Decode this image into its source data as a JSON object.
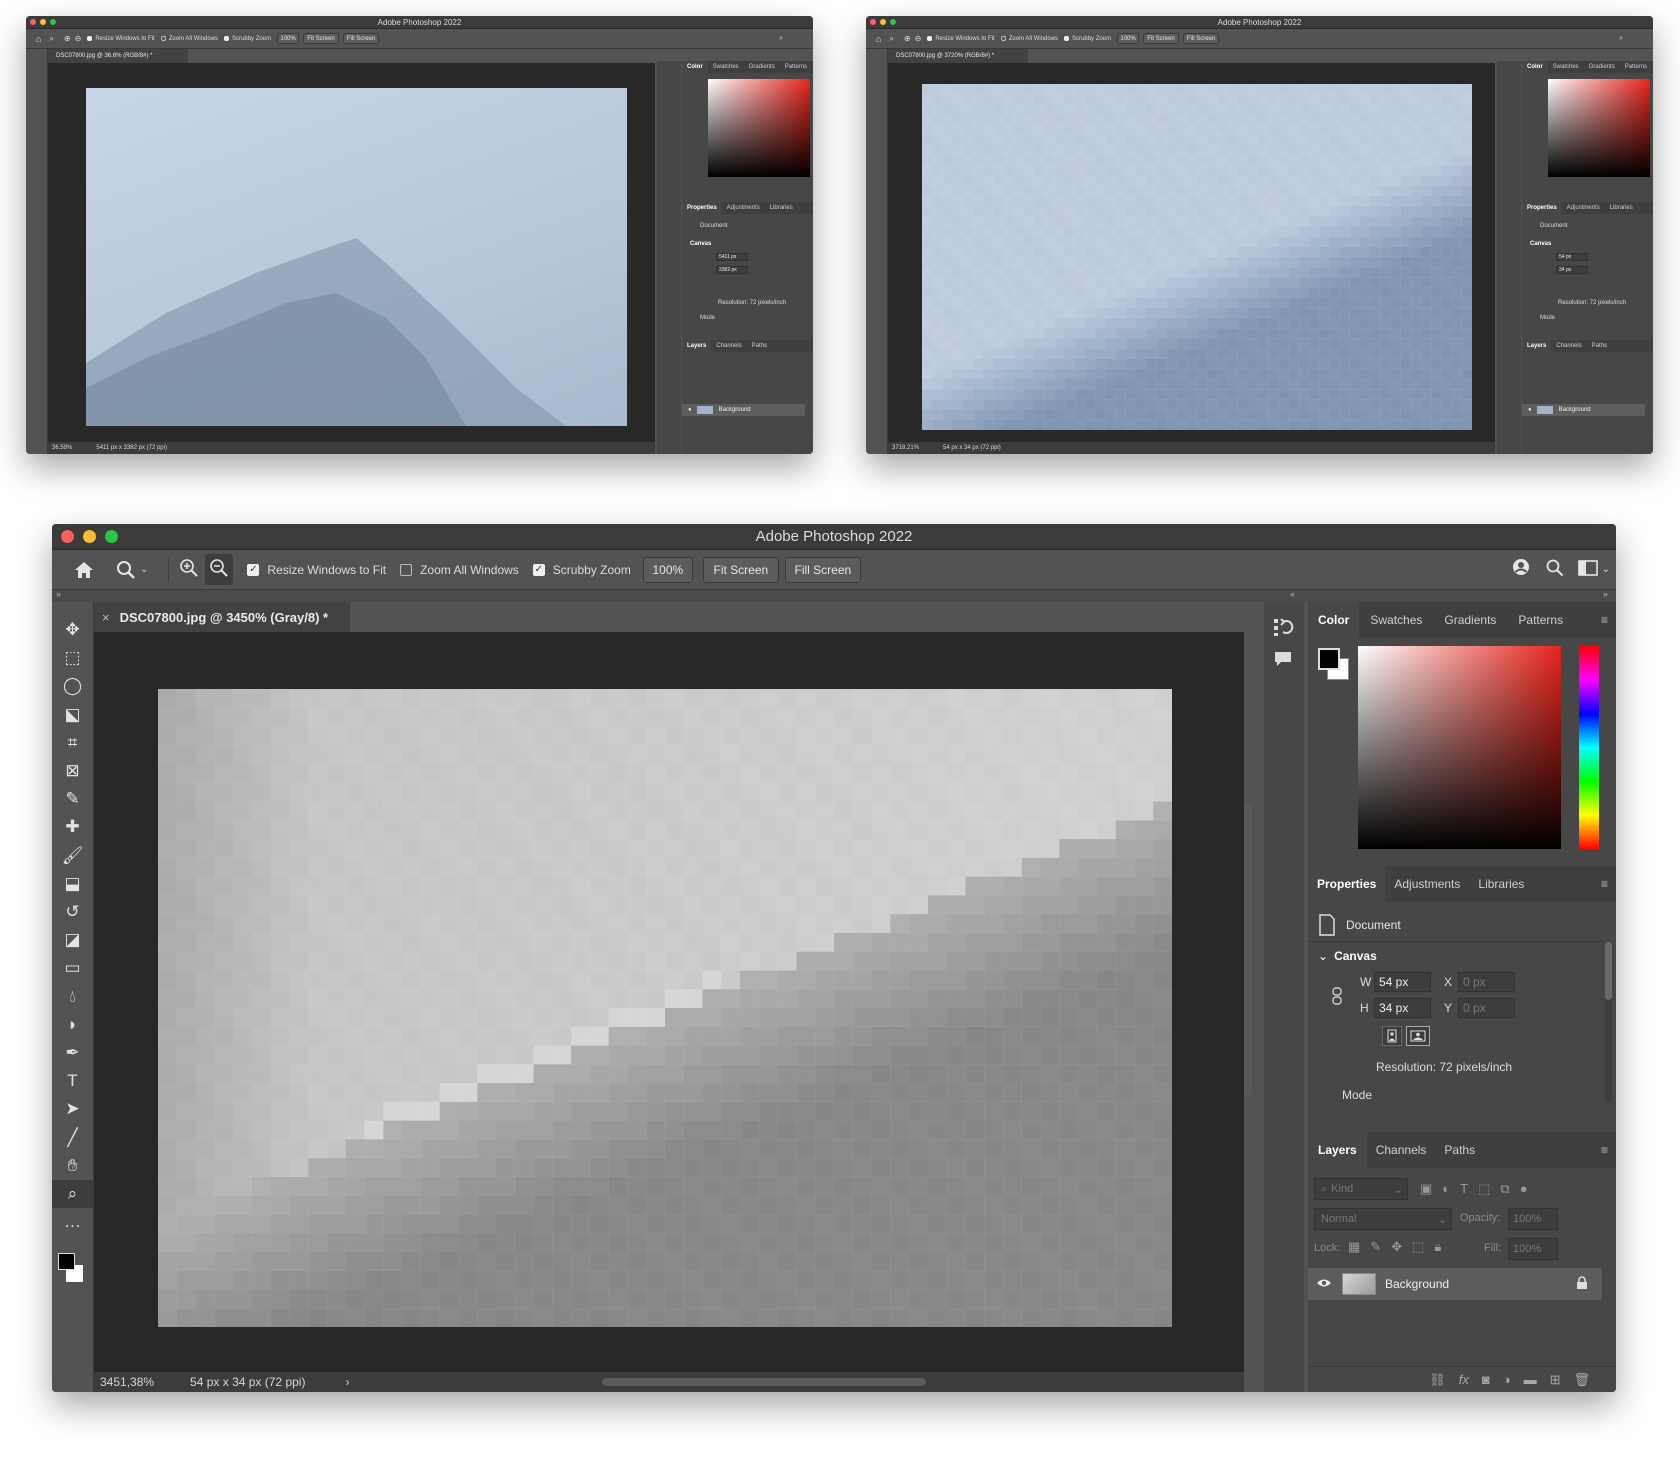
{
  "window": {
    "title": "Adobe Photoshop 2022"
  },
  "options_bar": {
    "resize_windows_label": "Resize Windows to Fit",
    "zoom_all_label": "Zoom All Windows",
    "scrubby_zoom_label": "Scrubby Zoom",
    "zoom_value": "100%",
    "fit_screen_label": "Fit Screen",
    "fill_screen_label": "Fill Screen",
    "resize_windows_checked": true,
    "zoom_all_checked": false,
    "scrubby_zoom_checked": true
  },
  "screens": [
    {
      "doc_tab": "DSC07800.jpg @ 36,6% (RGB/8#) *",
      "status_zoom": "36,59%",
      "status_size": "5411 px x 3382 px (72 ppi)",
      "width_value": "5411 px",
      "height_value": "3382 px"
    },
    {
      "doc_tab": "DSC07800.jpg @ 3720% (RGB/8#) *",
      "status_zoom": "3718,21%",
      "status_size": "54 px x 34 px (72 ppi)",
      "width_value": "54 px",
      "height_value": "34 px"
    },
    {
      "doc_tab": "DSC07800.jpg @ 3450% (Gray/8) *",
      "status_zoom": "3451,38%",
      "status_size": "54 px x 34 px (72 ppi)",
      "width_value": "54 px",
      "height_value": "34 px"
    }
  ],
  "color_panel": {
    "tabs": [
      "Color",
      "Swatches",
      "Gradients",
      "Patterns"
    ]
  },
  "properties_panel": {
    "tabs": [
      "Properties",
      "Adjustments",
      "Libraries"
    ],
    "document_label": "Document",
    "canvas_label": "Canvas",
    "w_label": "W",
    "h_label": "H",
    "x_label": "X",
    "y_label": "Y",
    "x_value": "0 px",
    "y_value": "0 px",
    "resolution": "Resolution: 72 pixels/inch",
    "mode_label": "Mode"
  },
  "layers_panel": {
    "tabs": [
      "Layers",
      "Channels",
      "Paths"
    ],
    "kind_placeholder": "Kind",
    "blend_mode": "Normal",
    "opacity_label": "Opacity:",
    "opacity_value": "100%",
    "lock_label": "Lock:",
    "fill_label": "Fill:",
    "fill_value": "100%",
    "layers": [
      {
        "name": "Background",
        "visible": true,
        "locked": true
      }
    ]
  },
  "icons": {
    "tools": [
      "move-icon",
      "marquee-icon",
      "lasso-icon",
      "object-select-icon",
      "crop-icon",
      "frame-icon",
      "eyedropper-icon",
      "healing-icon",
      "brush-icon",
      "stamp-icon",
      "history-brush-icon",
      "eraser-icon",
      "gradient-icon",
      "blur-icon",
      "dodge-icon",
      "pen-icon",
      "type-icon",
      "path-select-icon",
      "line-icon",
      "hand-icon",
      "zoom-icon",
      "more-tools-icon"
    ],
    "layer_footer": [
      "link-icon",
      "fx-icon",
      "mask-icon",
      "adjustment-icon",
      "folder-icon",
      "new-layer-icon",
      "trash-icon"
    ]
  },
  "colors": {
    "panel_bg": "#535353",
    "panel_dark": "#474747",
    "canvas_bg": "#282828",
    "photo_blue": "#b8c8db",
    "accent_red": "#e8241b"
  }
}
